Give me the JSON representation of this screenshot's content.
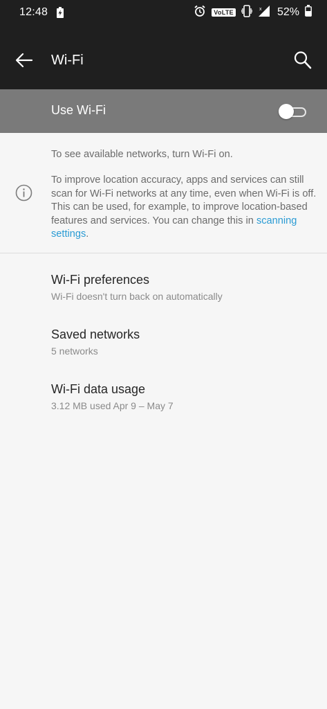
{
  "status_bar": {
    "time": "12:48",
    "volte_label": "VoLTE",
    "battery_percent": "52%",
    "icons": [
      "battery-charging-icon",
      "alarm-icon",
      "volte-icon",
      "vibrate-icon",
      "signal-icon",
      "battery-icon"
    ]
  },
  "app_bar": {
    "title": "Wi-Fi",
    "icons": [
      "back-arrow-icon",
      "search-icon"
    ]
  },
  "master_switch": {
    "label": "Use Wi-Fi",
    "state": "off"
  },
  "info": {
    "line1": "To see available networks, turn Wi-Fi on.",
    "body": "To improve location accuracy, apps and services can still scan for Wi-Fi networks at any time, even when Wi-Fi is off. This can be used, for example, to improve location-based features and services. You can change this in ",
    "link": "scanning settings",
    "end": ".",
    "icon": "info-icon"
  },
  "items": [
    {
      "title": "Wi-Fi preferences",
      "subtitle": "Wi-Fi doesn't turn back on automatically"
    },
    {
      "title": "Saved networks",
      "subtitle": "5 networks"
    },
    {
      "title": "Wi-Fi data usage",
      "subtitle": "3.12 MB used Apr 9 – May 7"
    }
  ],
  "colors": {
    "bar_bg": "#1f1f1f",
    "master_bg": "#7a7a7a",
    "page_bg": "#f6f6f6",
    "link": "#2a9bd4"
  }
}
